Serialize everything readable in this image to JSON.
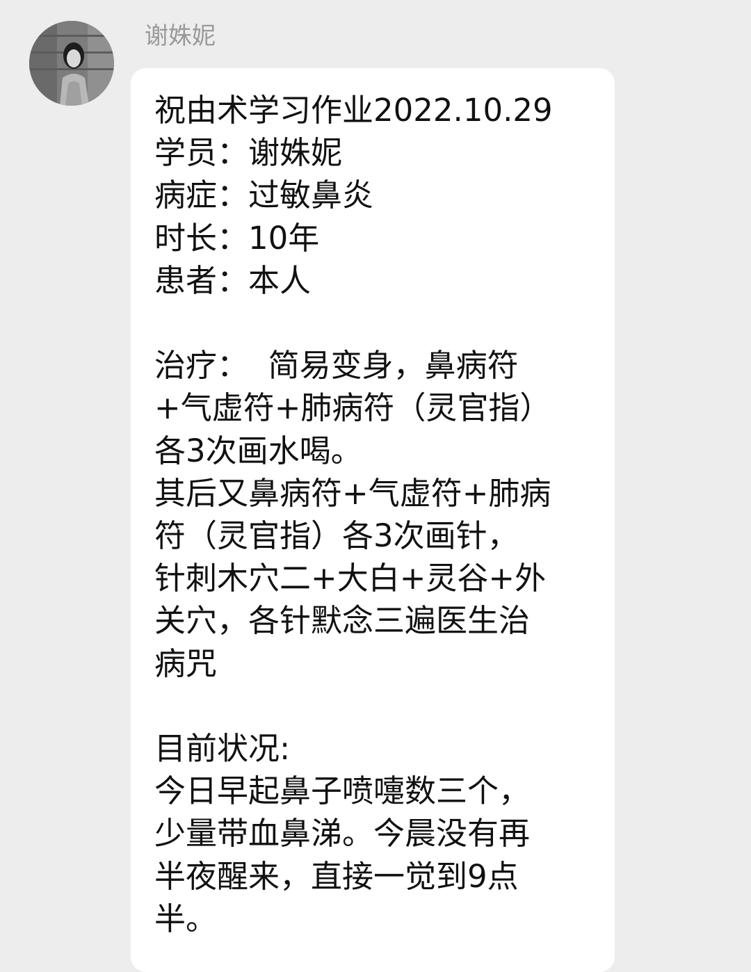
{
  "chat": {
    "sender_name": "谢姝妮",
    "avatar_icon": "user-photo-avatar",
    "message": {
      "lines": [
        "祝由术学习作业2022.10.29",
        "学员：谢姝妮",
        "病症：过敏鼻炎",
        "时长：10年",
        "患者：本人",
        "",
        "治疗：  简易变身，鼻病符",
        "+气虚符+肺病符（灵官指）",
        "各3次画水喝。",
        "其后又鼻病符+气虚符+肺病",
        "符（灵官指）各3次画针，",
        "针刺木穴二+大白+灵谷+外",
        "关穴，各针默念三遍医生治",
        "病咒",
        "",
        "目前状况:",
        "今日早起鼻子喷嚏数三个，",
        "少量带血鼻涕。今晨没有再",
        "半夜醒来，直接一觉到9点",
        "半。"
      ]
    }
  }
}
